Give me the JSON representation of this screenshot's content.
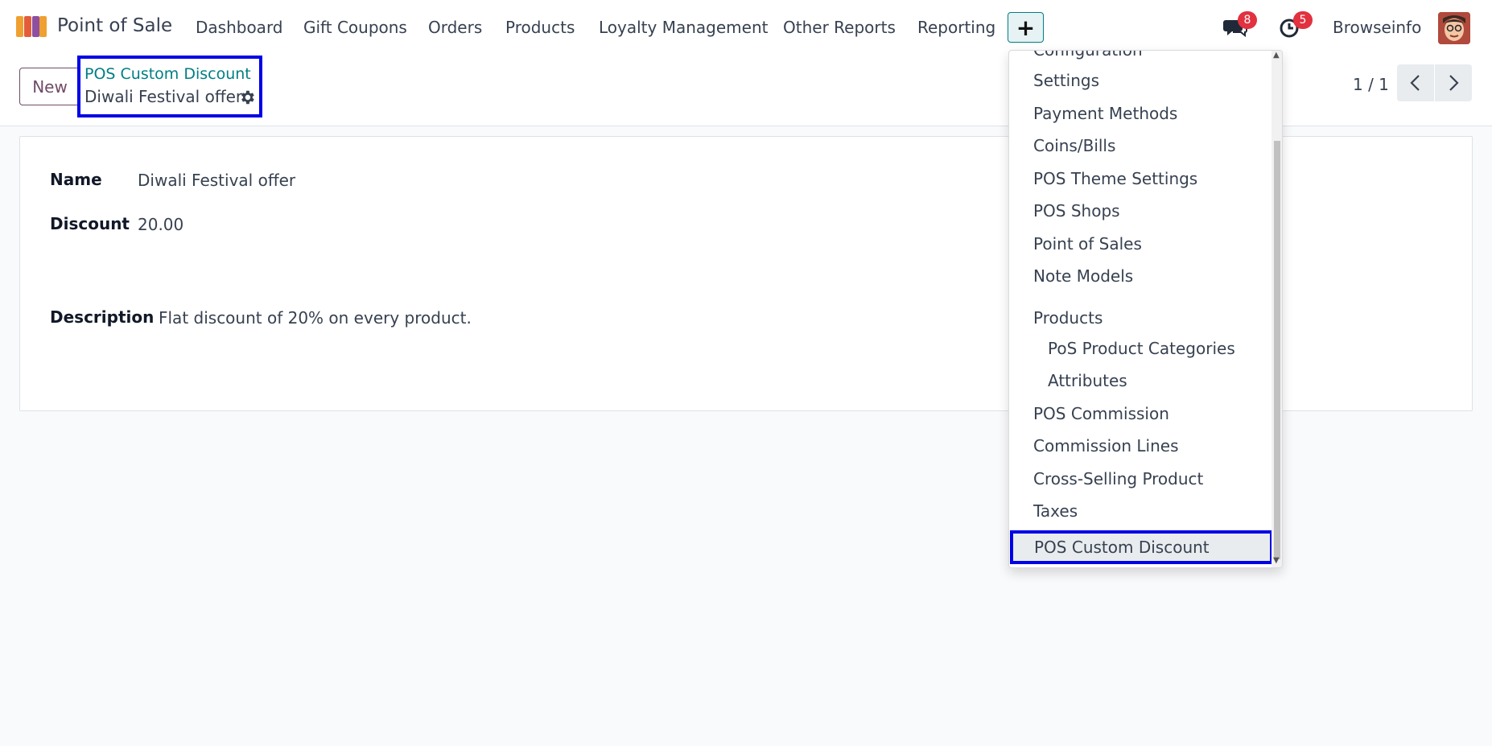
{
  "navbar": {
    "app_name": "Point of Sale",
    "menu": [
      "Dashboard",
      "Gift Coupons",
      "Orders",
      "Products",
      "Loyalty Management",
      "Other Reports",
      "Reporting"
    ],
    "plus_label": "+",
    "messages_count": "8",
    "activities_count": "5",
    "company": "Browseinfo"
  },
  "control": {
    "new_label": "New",
    "breadcrumb_parent": "POS Custom Discount",
    "breadcrumb_current": "Diwali Festival offer",
    "pager": "1 / 1"
  },
  "form": {
    "name_label": "Name",
    "name_value": "Diwali Festival offer",
    "discount_label": "Discount",
    "discount_value": "20.00",
    "description_label": "Description",
    "description_value": "Flat discount of 20% on every product."
  },
  "dropdown": {
    "header": "Configuration",
    "items": [
      "Settings",
      "Payment Methods",
      "Coins/Bills",
      "POS Theme Settings",
      "POS Shops",
      "Point of Sales",
      "Note Models"
    ],
    "products_section": "Products",
    "product_subitems": [
      "PoS Product Categories",
      "Attributes"
    ],
    "items_after": [
      "POS Commission",
      "Commission Lines",
      "Cross-Selling Product",
      "Taxes"
    ],
    "selected": "POS Custom Discount"
  },
  "colors": {
    "highlight": "#0000e6",
    "brand_teal": "#017e84",
    "brand_purple": "#714b67",
    "badge_red": "#e2313f"
  }
}
